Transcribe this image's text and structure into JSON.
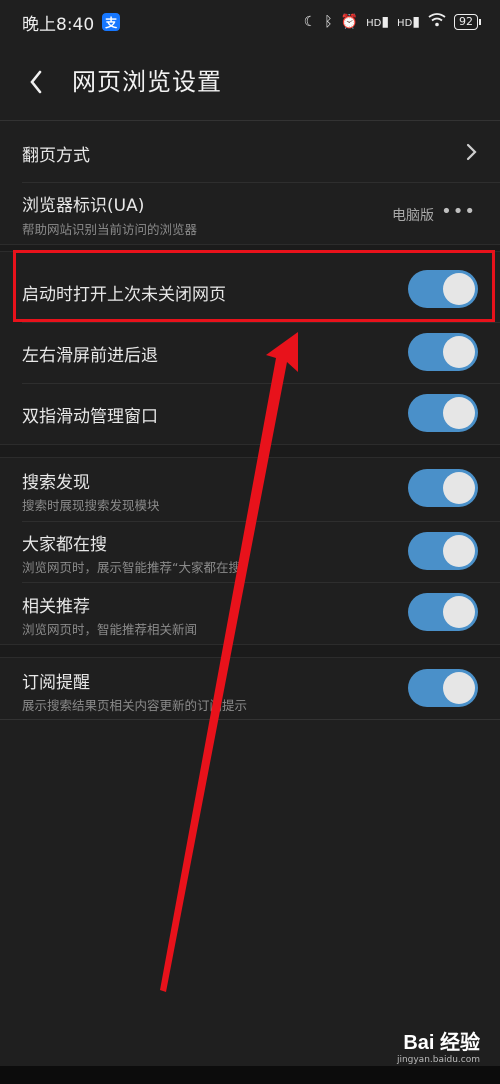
{
  "status": {
    "time": "晚上8:40",
    "app_badge": "支",
    "battery": "92",
    "hd1": "HD",
    "hd2": "HD"
  },
  "header": {
    "title": "网页浏览设置"
  },
  "settings": {
    "page_turn": {
      "title": "翻页方式"
    },
    "ua": {
      "title": "浏览器标识(UA)",
      "subtitle": "帮助网站识别当前访问的浏览器",
      "value": "电脑版",
      "more": "•••"
    },
    "restore_tabs": {
      "title": "启动时打开上次未关闭网页",
      "on": true
    },
    "swipe_nav": {
      "title": "左右滑屏前进后退",
      "on": true
    },
    "two_finger": {
      "title": "双指滑动管理窗口",
      "on": true
    },
    "search_discover": {
      "title": "搜索发现",
      "subtitle": "搜索时展现搜索发现模块",
      "on": true
    },
    "trending": {
      "title": "大家都在搜",
      "subtitle": "浏览网页时，展示智能推荐“大家都在搜”",
      "on": true
    },
    "related": {
      "title": "相关推荐",
      "subtitle": "浏览网页时，智能推荐相关新闻",
      "on": true
    },
    "subscribe": {
      "title": "订阅提醒",
      "subtitle": "展示搜索结果页相关内容更新的订阅提示",
      "on": true
    }
  },
  "colors": {
    "toggle_on": "#4a90c9",
    "highlight": "#e8121b",
    "background": "#1f1f1f"
  },
  "watermark": {
    "logo": "Bai 经验",
    "url": "jingyan.baidu.com"
  }
}
